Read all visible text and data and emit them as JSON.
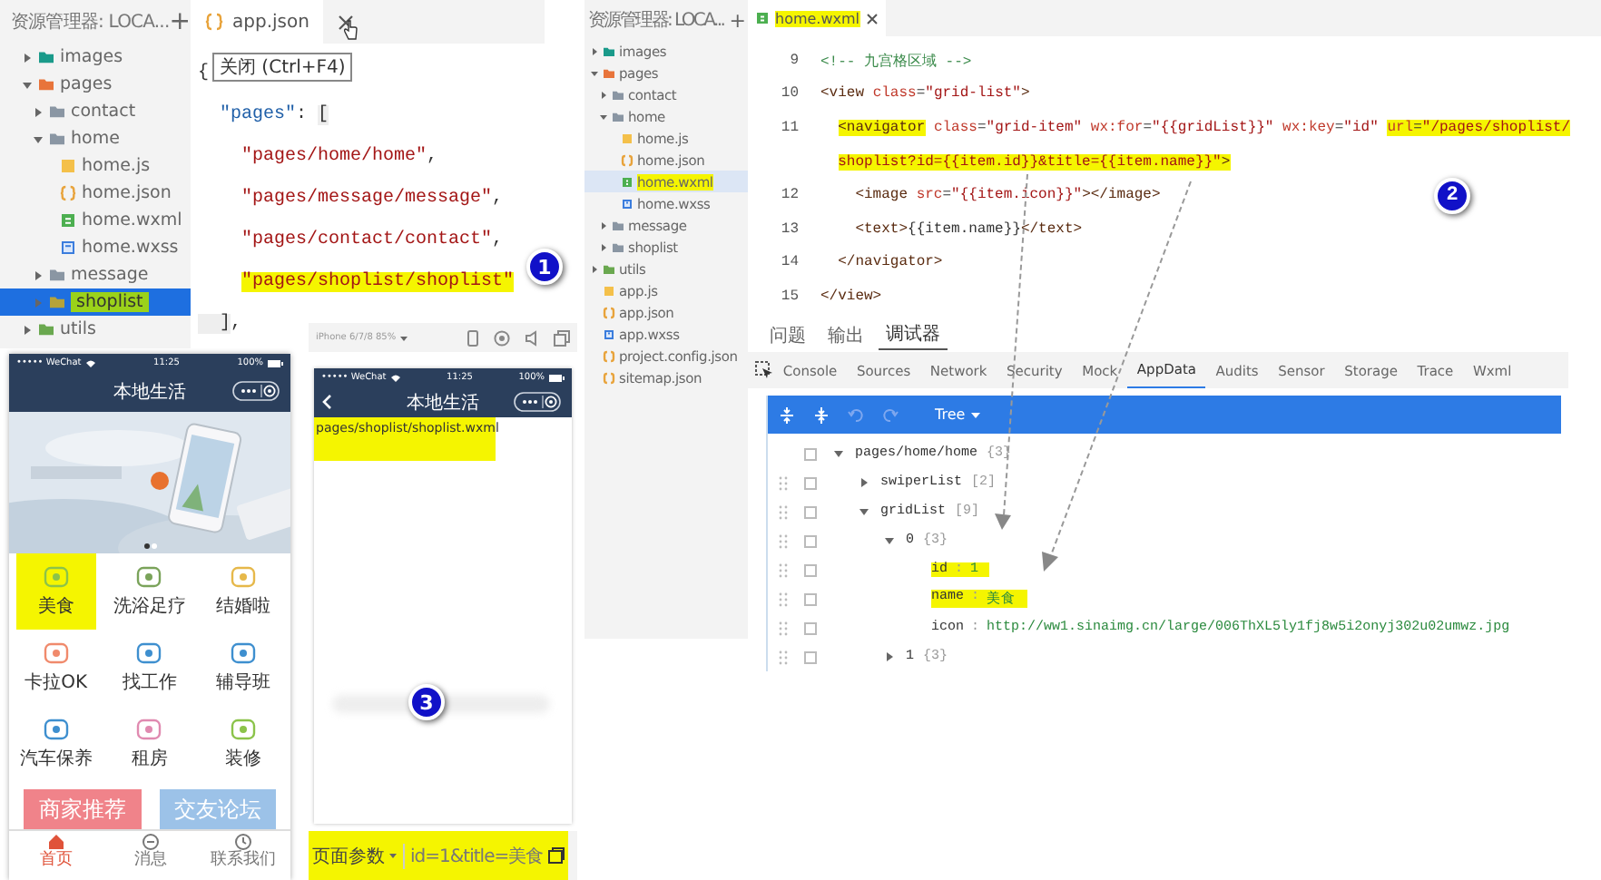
{
  "explorer_left": {
    "header": "资源管理器: LOCA...",
    "add": "+",
    "tree": [
      {
        "label": "images",
        "kind": "folder",
        "color": "#1a9a8a",
        "expanded": false,
        "selected": false
      },
      {
        "label": "pages",
        "kind": "folder",
        "color": "#e8743b",
        "expanded": true,
        "selected": false,
        "children": [
          {
            "label": "contact",
            "kind": "folder",
            "color": "#8a96a3",
            "expanded": false,
            "selected": false
          },
          {
            "label": "home",
            "kind": "folder",
            "color": "#8a96a3",
            "expanded": true,
            "selected": false,
            "children": [
              {
                "label": "home.js",
                "kind": "js",
                "selected": false
              },
              {
                "label": "home.json",
                "kind": "json",
                "selected": false
              },
              {
                "label": "home.wxml",
                "kind": "wxml",
                "selected": false
              },
              {
                "label": "home.wxss",
                "kind": "wxss",
                "selected": false
              }
            ]
          },
          {
            "label": "message",
            "kind": "folder",
            "color": "#8a96a3",
            "expanded": false,
            "selected": false
          },
          {
            "label": "shoplist",
            "kind": "folder",
            "color": "#b5a33a",
            "expanded": false,
            "selected": true
          }
        ]
      },
      {
        "label": "utils",
        "kind": "folder",
        "color": "#6aa84f",
        "expanded": false,
        "selected": false
      }
    ]
  },
  "editor_left": {
    "tab": "app.json",
    "tooltip": "关闭 (Ctrl+F4)",
    "badge": "1",
    "lines": [
      {
        "segments": [
          {
            "kind": "punct",
            "text": "{",
            "highlighted": false
          }
        ]
      },
      {
        "segments": [
          {
            "kind": "key",
            "text": "  \"pages\"",
            "highlighted": false
          },
          {
            "kind": "punct",
            "text": ": ",
            "highlighted": false
          },
          {
            "kind": "bracket",
            "text": "[",
            "highlighted": false
          }
        ]
      },
      {
        "segments": [
          {
            "kind": "string",
            "text": "    \"pages/home/home\"",
            "highlighted": false
          },
          {
            "kind": "punct",
            "text": ",",
            "highlighted": false
          }
        ]
      },
      {
        "segments": [
          {
            "kind": "string",
            "text": "    \"pages/message/message\"",
            "highlighted": false
          },
          {
            "kind": "punct",
            "text": ",",
            "highlighted": false
          }
        ]
      },
      {
        "segments": [
          {
            "kind": "string",
            "text": "    \"pages/contact/contact\"",
            "highlighted": false
          },
          {
            "kind": "punct",
            "text": ",",
            "highlighted": false
          }
        ]
      },
      {
        "segments": [
          {
            "kind": "string",
            "text": "    \"pages/shoplist/shoplist\"",
            "highlighted": true
          }
        ]
      },
      {
        "segments": [
          {
            "kind": "bracket",
            "text": "  ]",
            "highlighted": false
          },
          {
            "kind": "punct",
            "text": ",",
            "highlighted": false
          }
        ]
      }
    ]
  },
  "phone": {
    "carrier": "••••• WeChat",
    "time": "11:25",
    "battery": "100%",
    "title": "本地生活",
    "grid": [
      {
        "label": "美食",
        "highlighted": true
      },
      {
        "label": "洗浴足疗",
        "highlighted": false
      },
      {
        "label": "结婚啦",
        "highlighted": false
      },
      {
        "label": "卡拉OK",
        "highlighted": false
      },
      {
        "label": "找工作",
        "highlighted": false
      },
      {
        "label": "辅导班",
        "highlighted": false
      },
      {
        "label": "汽车保养",
        "highlighted": false
      },
      {
        "label": "租房",
        "highlighted": false
      },
      {
        "label": "装修",
        "highlighted": false
      }
    ],
    "cards": [
      {
        "label": "商家推荐",
        "color": "#f0838a"
      },
      {
        "label": "交友论坛",
        "color": "#9cc2e8"
      }
    ],
    "tabs": [
      {
        "label": "首页",
        "selected": true
      },
      {
        "label": "消息",
        "selected": false
      },
      {
        "label": "联系我们",
        "selected": false
      }
    ]
  },
  "simulator": {
    "device": "iPhone 6/7/8 85%",
    "carrier": "••••• WeChat",
    "time": "11:25",
    "battery": "100%",
    "title": "本地生活",
    "page_path": "pages/shoplist/shoplist.wxml",
    "badge": "3",
    "params_label": "页面参数",
    "params": "id=1&title=美食"
  },
  "explorer_right": {
    "header": "资源管理器: LOCA...",
    "add": "+",
    "tree": [
      {
        "label": "images",
        "kind": "folder",
        "color": "#1a9a8a",
        "expanded": false,
        "selected": false
      },
      {
        "label": "pages",
        "kind": "folder",
        "color": "#e8743b",
        "expanded": true,
        "selected": false,
        "children": [
          {
            "label": "contact",
            "kind": "folder",
            "color": "#8a96a3",
            "expanded": false,
            "selected": false
          },
          {
            "label": "home",
            "kind": "folder",
            "color": "#8a96a3",
            "expanded": true,
            "selected": false,
            "children": [
              {
                "label": "home.js",
                "kind": "js",
                "selected": false
              },
              {
                "label": "home.json",
                "kind": "json",
                "selected": false
              },
              {
                "label": "home.wxml",
                "kind": "wxml",
                "selected": true
              },
              {
                "label": "home.wxss",
                "kind": "wxss",
                "selected": false
              }
            ]
          },
          {
            "label": "message",
            "kind": "folder",
            "color": "#8a96a3",
            "expanded": false,
            "selected": false
          },
          {
            "label": "shoplist",
            "kind": "folder",
            "color": "#8a96a3",
            "expanded": false,
            "selected": false
          }
        ]
      },
      {
        "label": "utils",
        "kind": "folder",
        "color": "#6aa84f",
        "expanded": false,
        "selected": false
      },
      {
        "label": "app.js",
        "kind": "js",
        "selected": false
      },
      {
        "label": "app.json",
        "kind": "json",
        "selected": false
      },
      {
        "label": "app.wxss",
        "kind": "wxss",
        "selected": false
      },
      {
        "label": "project.config.json",
        "kind": "json",
        "selected": false
      },
      {
        "label": "sitemap.json",
        "kind": "json",
        "selected": false
      }
    ]
  },
  "editor_right": {
    "tab": "home.wxml",
    "badge": "2",
    "lines": [
      {
        "number": "9",
        "segments": [
          {
            "kind": "comment",
            "text": "<!-- 九宫格区域 -->",
            "highlighted": false
          }
        ]
      },
      {
        "number": "10",
        "segments": [
          {
            "kind": "tag",
            "text": "<view",
            "highlighted": false
          },
          {
            "kind": "attr",
            "text": " class",
            "highlighted": false
          },
          {
            "kind": "punct",
            "text": "=",
            "highlighted": false
          },
          {
            "kind": "string",
            "text": "\"grid-list\"",
            "highlighted": false
          },
          {
            "kind": "tag",
            "text": ">",
            "highlighted": false
          }
        ]
      },
      {
        "number": "11",
        "segments": [
          {
            "kind": "tag",
            "text": "  <navigator",
            "highlighted": true
          },
          {
            "kind": "attr",
            "text": " class",
            "highlighted": false
          },
          {
            "kind": "punct",
            "text": "=",
            "highlighted": false
          },
          {
            "kind": "string",
            "text": "\"grid-item\"",
            "highlighted": false
          },
          {
            "kind": "attr",
            "text": " wx:for",
            "highlighted": false
          },
          {
            "kind": "punct",
            "text": "=",
            "highlighted": false
          },
          {
            "kind": "string",
            "text": "\"{{gridList}}\"",
            "highlighted": false
          },
          {
            "kind": "attr",
            "text": " wx:key",
            "highlighted": false
          },
          {
            "kind": "punct",
            "text": "=",
            "highlighted": false
          },
          {
            "kind": "string",
            "text": "\"id\" ",
            "highlighted": false
          },
          {
            "kind": "attr",
            "text": "url",
            "highlighted": true
          },
          {
            "kind": "punct",
            "text": "=",
            "highlighted": true
          },
          {
            "kind": "string",
            "text": "\"/pages/shoplist/",
            "highlighted": true
          }
        ]
      },
      {
        "segments": [
          {
            "kind": "string",
            "text": "  shoplist?id={{item.id}}&title={{item.name}}\"",
            "highlighted": true
          },
          {
            "kind": "tag",
            "text": ">",
            "highlighted": true
          }
        ]
      },
      {
        "number": "12",
        "segments": [
          {
            "kind": "tag",
            "text": "    <image",
            "highlighted": false
          },
          {
            "kind": "attr",
            "text": " src",
            "highlighted": false
          },
          {
            "kind": "punct",
            "text": "=",
            "highlighted": false
          },
          {
            "kind": "string",
            "text": "\"{{item.icon}}\"",
            "highlighted": false
          },
          {
            "kind": "tag",
            "text": "></image>",
            "highlighted": false
          }
        ]
      },
      {
        "number": "13",
        "segments": [
          {
            "kind": "tag",
            "text": "    <text>",
            "highlighted": false
          },
          {
            "kind": "text",
            "text": "{{item.name}}",
            "highlighted": false
          },
          {
            "kind": "tag",
            "text": "</text>",
            "highlighted": false
          }
        ]
      },
      {
        "number": "14",
        "segments": [
          {
            "kind": "tag",
            "text": "  </navigator>",
            "highlighted": false
          }
        ]
      },
      {
        "number": "15",
        "segments": [
          {
            "kind": "tag",
            "text": "</view>",
            "highlighted": false
          }
        ]
      }
    ]
  },
  "debugger": {
    "panel_tabs": [
      {
        "label": "问题",
        "selected": false
      },
      {
        "label": "输出",
        "selected": false
      },
      {
        "label": "调试器",
        "selected": true
      }
    ],
    "tools": [
      {
        "label": "Console",
        "selected": false
      },
      {
        "label": "Sources",
        "selected": false
      },
      {
        "label": "Network",
        "selected": false
      },
      {
        "label": "Security",
        "selected": false
      },
      {
        "label": "Mock",
        "selected": false
      },
      {
        "label": "AppData",
        "selected": true
      },
      {
        "label": "Audits",
        "selected": false
      },
      {
        "label": "Sensor",
        "selected": false
      },
      {
        "label": "Storage",
        "selected": false
      },
      {
        "label": "Trace",
        "selected": false
      },
      {
        "label": "Wxml",
        "selected": false
      }
    ],
    "view_mode": "Tree",
    "data": [
      {
        "label": "pages/home/home",
        "count": "{3}",
        "expanded": true,
        "checked": false,
        "children": [
          {
            "label": "swiperList",
            "count": "[2]",
            "expanded": false,
            "checked": false
          },
          {
            "label": "gridList",
            "count": "[9]",
            "expanded": true,
            "checked": false,
            "children": [
              {
                "label": "0",
                "count": "{3}",
                "expanded": true,
                "checked": false,
                "children": [
                  {
                    "key": "id",
                    "sep": ":",
                    "value": "1",
                    "highlighted": true,
                    "checked": false
                  },
                  {
                    "key": "name",
                    "sep": ":",
                    "value": "美食",
                    "highlighted": true,
                    "checked": false
                  },
                  {
                    "key": "icon",
                    "sep": ":",
                    "value": "http://ww1.sinaimg.cn/large/006ThXL5ly1fj8w5i2onyj302u02umwz.jpg",
                    "highlighted": false,
                    "checked": false
                  }
                ]
              },
              {
                "label": "1",
                "count": "{3}",
                "expanded": false,
                "checked": false
              }
            ]
          }
        ]
      }
    ]
  }
}
